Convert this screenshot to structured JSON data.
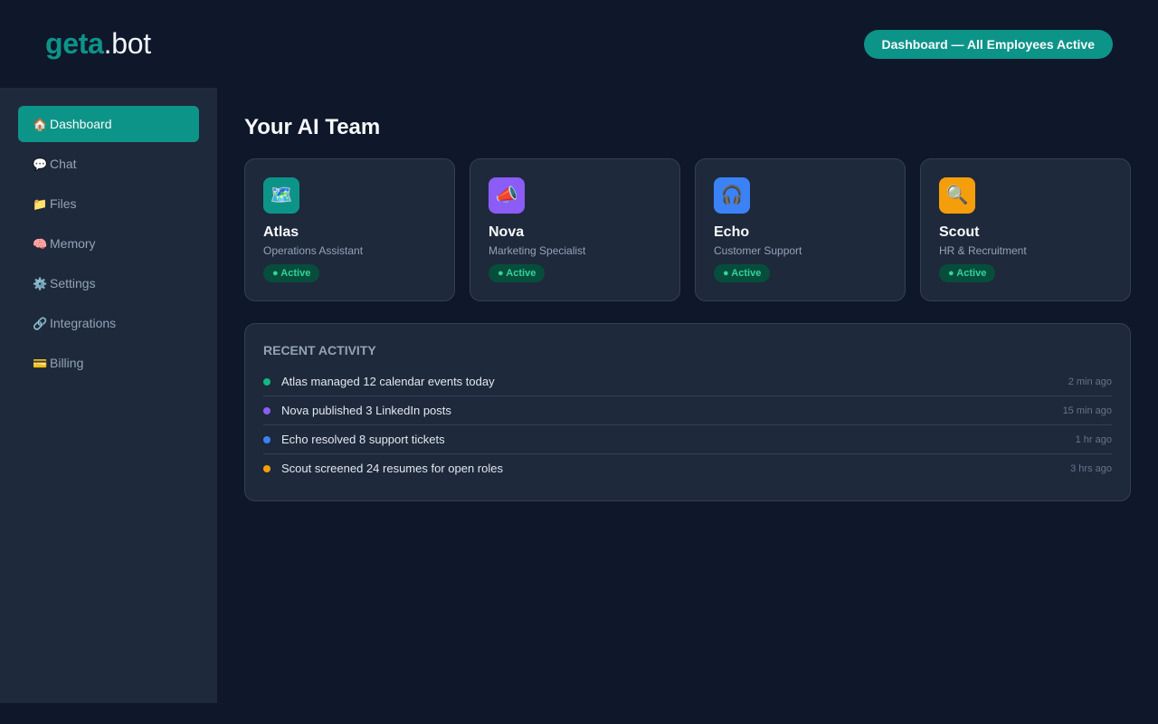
{
  "header": {
    "logo_brand": "geta",
    "logo_tld": ".bot",
    "status_pill": "Dashboard — All Employees Active"
  },
  "sidebar": {
    "items": [
      {
        "icon": "🏠",
        "icon_name": "home-icon",
        "label": "Dashboard",
        "active": true
      },
      {
        "icon": "💬",
        "icon_name": "chat-icon",
        "label": "Chat",
        "active": false
      },
      {
        "icon": "📁",
        "icon_name": "folder-icon",
        "label": "Files",
        "active": false
      },
      {
        "icon": "🧠",
        "icon_name": "brain-icon",
        "label": "Memory",
        "active": false
      },
      {
        "icon": "⚙️",
        "icon_name": "gear-icon",
        "label": "Settings",
        "active": false
      },
      {
        "icon": "🔗",
        "icon_name": "link-icon",
        "label": "Integrations",
        "active": false
      },
      {
        "icon": "💳",
        "icon_name": "credit-card-icon",
        "label": "Billing",
        "active": false
      }
    ]
  },
  "main": {
    "title": "Your AI Team",
    "employees": [
      {
        "name": "Atlas",
        "role": "Operations Assistant",
        "status": "● Active",
        "icon": "🗺️",
        "icon_name": "map-icon",
        "color": "#0d9488"
      },
      {
        "name": "Nova",
        "role": "Marketing Specialist",
        "status": "● Active",
        "icon": "📣",
        "icon_name": "megaphone-icon",
        "color": "#8b5cf6"
      },
      {
        "name": "Echo",
        "role": "Customer Support",
        "status": "● Active",
        "icon": "🎧",
        "icon_name": "headphones-icon",
        "color": "#3b82f6"
      },
      {
        "name": "Scout",
        "role": "HR & Recruitment",
        "status": "● Active",
        "icon": "🔍",
        "icon_name": "magnifier-icon",
        "color": "#f59e0b"
      }
    ],
    "activity": {
      "title": "RECENT ACTIVITY",
      "items": [
        {
          "text": "Atlas managed 12 calendar events today",
          "time": "2 min ago",
          "color": "#10b981"
        },
        {
          "text": "Nova published 3 LinkedIn posts",
          "time": "15 min ago",
          "color": "#8b5cf6"
        },
        {
          "text": "Echo resolved 8 support tickets",
          "time": "1 hr ago",
          "color": "#3b82f6"
        },
        {
          "text": "Scout screened 24 resumes for open roles",
          "time": "3 hrs ago",
          "color": "#f59e0b"
        }
      ]
    }
  },
  "colors": {
    "accent": "#0d9488",
    "background": "#0f172a",
    "panel": "#1e293b",
    "active_badge_bg": "#064e3b",
    "active_badge_text": "#34d399"
  }
}
